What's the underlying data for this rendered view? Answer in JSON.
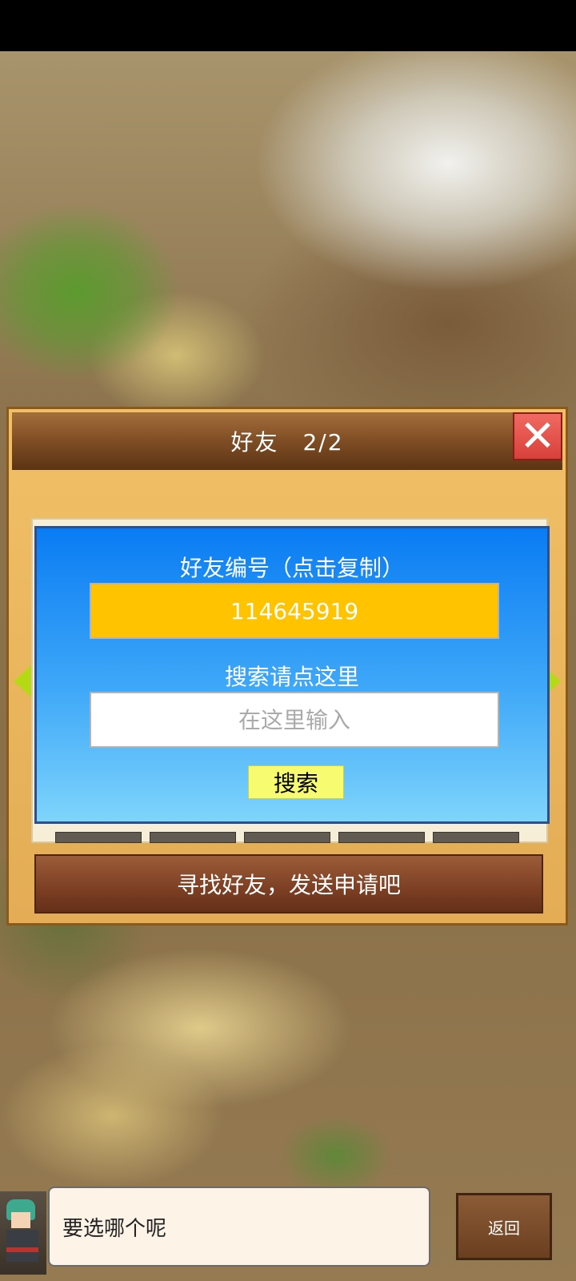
{
  "dialog": {
    "title": "好友",
    "page_indicator": "2/2",
    "close_label": "✕"
  },
  "panel": {
    "friend_id_label": "好友编号（点击复制）",
    "friend_id": "114645919",
    "search_hint": "搜索请点这里",
    "search_placeholder": "在这里输入",
    "search_button": "搜索"
  },
  "message": "寻找好友，发送申请吧",
  "bottom": {
    "speech": "要选哪个呢",
    "back_button": "返回"
  },
  "colors": {
    "friend_id_bg": "#ffc300",
    "search_button_bg": "#f6fb6f",
    "close_button_bg": "#e0504a",
    "nav_arrow": "#b6d916"
  },
  "icons": {
    "close": "close-icon",
    "prev": "arrow-left-icon",
    "next": "arrow-right-icon"
  }
}
